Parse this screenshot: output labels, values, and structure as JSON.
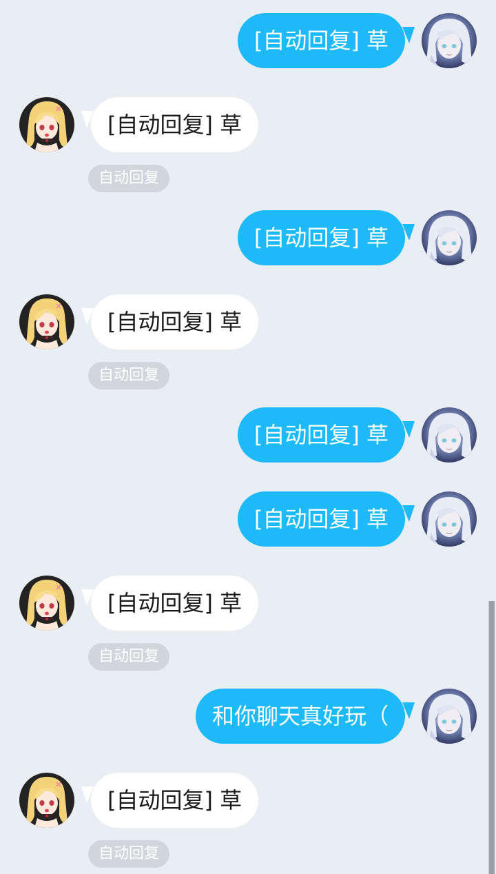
{
  "messages": [
    {
      "side": "out",
      "text": "[自动回复] 草",
      "avatar": "silver-hair-avatar"
    },
    {
      "side": "in",
      "text": "[自动回复] 草",
      "tag": "自动回复",
      "avatar": "blonde-girl-avatar"
    },
    {
      "side": "out",
      "text": "[自动回复] 草",
      "avatar": "silver-hair-avatar"
    },
    {
      "side": "in",
      "text": "[自动回复] 草",
      "tag": "自动回复",
      "avatar": "blonde-girl-avatar"
    },
    {
      "side": "out",
      "text": "[自动回复] 草",
      "avatar": "silver-hair-avatar"
    },
    {
      "side": "out",
      "text": "[自动回复] 草",
      "avatar": "silver-hair-avatar"
    },
    {
      "side": "in",
      "text": "[自动回复] 草",
      "tag": "自动回复",
      "avatar": "blonde-girl-avatar"
    },
    {
      "side": "out",
      "text": "和你聊天真好玩（",
      "avatar": "silver-hair-avatar"
    },
    {
      "side": "in",
      "text": "[自动回复] 草",
      "tag": "自动回复",
      "avatar": "blonde-girl-avatar"
    }
  ],
  "colors": {
    "background": "#e9edf4",
    "outgoing_bubble": "#1ebaf8",
    "incoming_bubble": "#ffffff",
    "auto_reply_tag": "#d2d6dc"
  }
}
